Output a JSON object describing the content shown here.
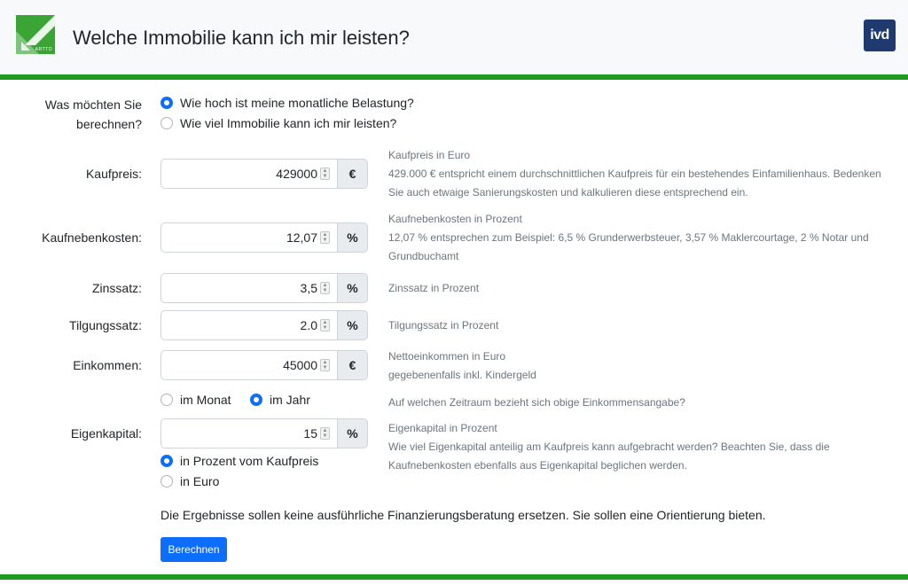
{
  "header": {
    "title": "Welche Immobilie kann ich mir leisten?",
    "logo_text": "ARTTO",
    "partner_logo": "ivd"
  },
  "mode": {
    "label_line1": "Was möchten Sie",
    "label_line2": "berechnen?",
    "options": [
      {
        "label": "Wie hoch ist meine monatliche Belastung?",
        "checked": true
      },
      {
        "label": "Wie viel Immobilie kann ich mir leisten?",
        "checked": false
      }
    ]
  },
  "fields": {
    "kaufpreis": {
      "label": "Kaufpreis:",
      "value": "429000",
      "unit": "€",
      "help_title": "Kaufpreis in Euro",
      "help_line1": "429.000 € entspricht einem durchschnittlichen Kaufpreis für ein bestehendes Einfamilienhaus. Bedenken",
      "help_line2": "Sie auch etwaige Sanierungskosten und kalkulieren diese entsprechend ein."
    },
    "kaufnebenkosten": {
      "label": "Kaufnebenkosten:",
      "value": "12,07",
      "unit": "%",
      "help_title": "Kaufnebenkosten in Prozent",
      "help_line1": "12,07 % entsprechen zum Beispiel: 6,5 % Grunderwerbsteuer, 3,57 % Maklercourtage, 2 % Notar und",
      "help_line2": "Grundbuchamt"
    },
    "zinssatz": {
      "label": "Zinssatz:",
      "value": "3,5",
      "unit": "%",
      "help_title": "Zinssatz in Prozent"
    },
    "tilgungssatz": {
      "label": "Tilgungssatz:",
      "value": "2.0",
      "unit": "%",
      "help_title": "Tilgungssatz in Prozent"
    },
    "einkommen": {
      "label": "Einkommen:",
      "value": "45000",
      "unit": "€",
      "help_title": "Nettoeinkommen in Euro",
      "help_line1": "gegebenenfalls inkl. Kindergeld"
    },
    "eigenkapital": {
      "label": "Eigenkapital:",
      "value": "15",
      "unit": "%",
      "help_title": "Eigenkapital in Prozent",
      "help_line1": "Wie viel Eigenkapital anteilig am Kaufpreis kann aufgebracht werden? Beachten Sie, dass die",
      "help_line2": "Kaufnebenkosten ebenfalls aus Eigenkapital beglichen werden."
    }
  },
  "income_period": {
    "options": [
      {
        "label": "im Monat",
        "checked": false
      },
      {
        "label": "im Jahr",
        "checked": true
      }
    ],
    "help": "Auf welchen Zeitraum bezieht sich obige Einkommensangabe?"
  },
  "equity_mode": {
    "options": [
      {
        "label": "in Prozent vom Kaufpreis",
        "checked": true
      },
      {
        "label": "in Euro",
        "checked": false
      }
    ]
  },
  "disclaimer": "Die Ergebnisse sollen keine ausführliche Finanzierungsberatung ersetzen. Sie sollen eine Orientierung bieten.",
  "submit_label": "Berechnen",
  "colors": {
    "accent": "#0d6efd",
    "green_bar": "#1e9a1e",
    "logo_green": "#3aa535",
    "ivd_blue": "#1e3a6e"
  }
}
